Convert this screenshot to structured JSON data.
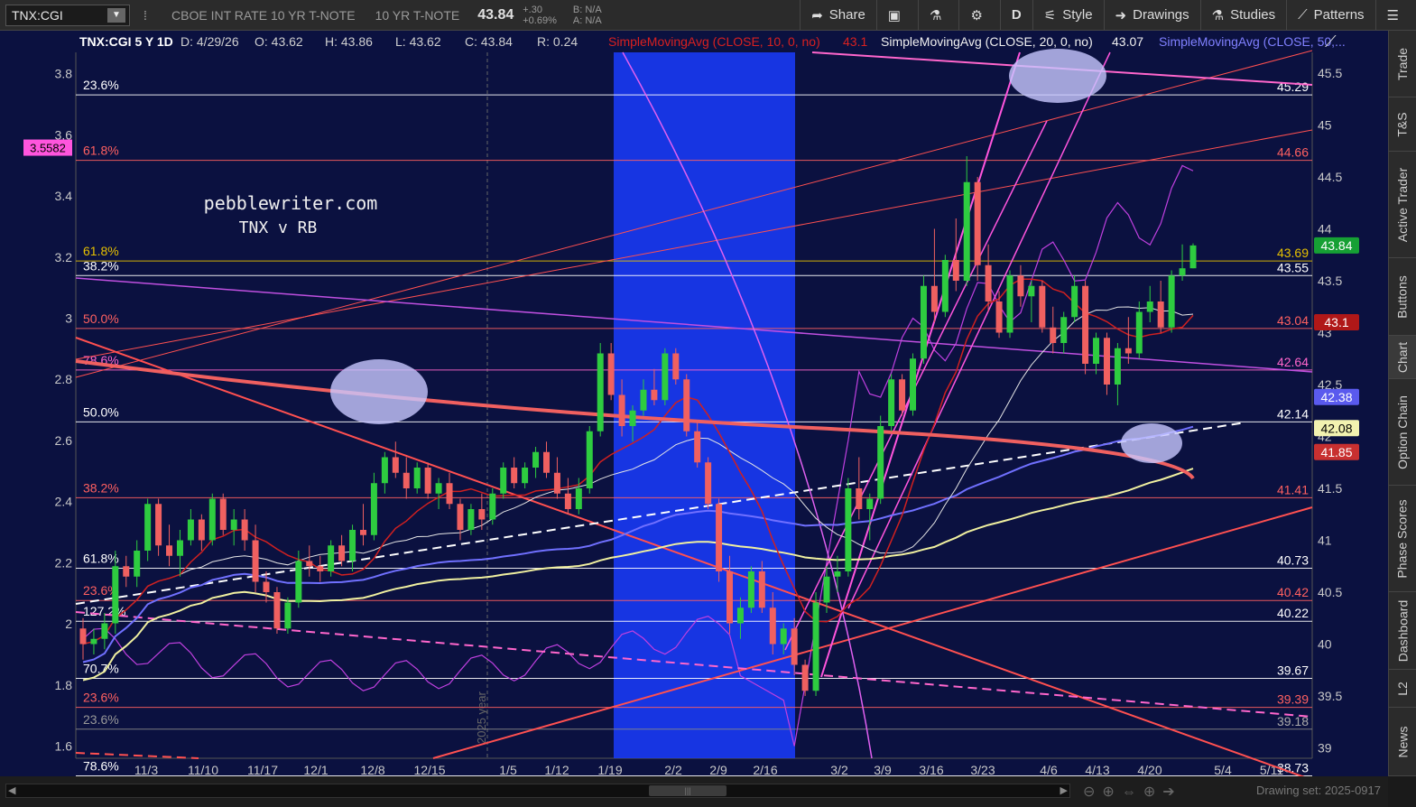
{
  "toolbar": {
    "symbol": "TNX:CGI",
    "description": "CBOE INT RATE 10 YR T-NOTE",
    "short_desc": "10 YR T-NOTE",
    "last": "43.84",
    "change": "+.30",
    "change_pct": "+0.69%",
    "bid": "B: N/A",
    "ask": "A: N/A",
    "share": "Share",
    "period": "D",
    "style": "Style",
    "drawings": "Drawings",
    "studies": "Studies",
    "patterns": "Patterns"
  },
  "sidebar": [
    "Trade",
    "T&S",
    "Active Trader",
    "Buttons",
    "Chart",
    "Option Chain",
    "Phase Scores",
    "Dashboard",
    "L2",
    "News"
  ],
  "header": {
    "symbol_period": "TNX:CGI 5 Y 1D",
    "date": "D: 4/29/26",
    "open": "O: 43.62",
    "high": "H: 43.86",
    "low": "L: 43.62",
    "close": "C: 43.84",
    "range": "R: 0.24",
    "sma10": "SimpleMovingAvg (CLOSE, 10, 0, no)",
    "sma10_val": "43.1",
    "sma20": "SimpleMovingAvg (CLOSE, 20, 0, no)",
    "sma20_val": "43.07",
    "sma50": "SimpleMovingAvg (CLOSE, 50,..."
  },
  "watermark": [
    "pebblewriter.com",
    "TNX v RB"
  ],
  "year_marker": "2025 year",
  "bottom": {
    "drawing_set": "Drawing set: 2025-0917"
  },
  "colors": {
    "background": "#0b1140",
    "up": "#2ecc40",
    "down": "#f06060",
    "sma10": "#d02020",
    "sma20": "#e6e6e6",
    "sma50": "#7070ff",
    "sma200": "#f0f0a0",
    "rb": "#c040e0",
    "channel": "#ff66cc",
    "fib_red": "#ff6060",
    "highlight_band": "#1a3cff"
  },
  "chart_data": {
    "type": "candlestick",
    "x_axis_labels": [
      "11/3",
      "11/10",
      "11/17",
      "12/1",
      "12/8",
      "12/15",
      "1/5",
      "1/12",
      "1/19",
      "2/2",
      "2/9",
      "2/16",
      "3/2",
      "3/9",
      "3/16",
      "3/23",
      "4/6",
      "4/13",
      "4/20",
      "5/4",
      "5/11"
    ],
    "right_axis": {
      "ticks": [
        39,
        39.5,
        40,
        40.5,
        41,
        41.5,
        42,
        42.5,
        43,
        43.5,
        44,
        44.5,
        45,
        45.5
      ],
      "range": [
        38.9,
        45.7
      ]
    },
    "left_axis": {
      "ticks": [
        1.6,
        1.8,
        2,
        2.2,
        2.4,
        2.6,
        2.8,
        3,
        3.2,
        3.4,
        3.6,
        3.8
      ],
      "range": [
        1.56,
        3.87
      ],
      "marker": "3.5582"
    },
    "candles": [
      [
        40.15,
        40.25,
        39.85,
        40.0
      ],
      [
        40.0,
        40.15,
        39.9,
        40.05
      ],
      [
        40.05,
        40.3,
        39.95,
        40.2
      ],
      [
        40.2,
        40.9,
        40.1,
        40.75
      ],
      [
        40.75,
        40.85,
        40.55,
        40.65
      ],
      [
        40.65,
        41.0,
        40.55,
        40.9
      ],
      [
        40.9,
        41.4,
        40.8,
        41.35
      ],
      [
        41.35,
        41.4,
        40.85,
        40.95
      ],
      [
        40.95,
        41.15,
        40.75,
        40.85
      ],
      [
        40.85,
        41.1,
        40.65,
        41.0
      ],
      [
        41.0,
        41.3,
        40.95,
        41.2
      ],
      [
        41.2,
        41.25,
        40.9,
        41.0
      ],
      [
        41.0,
        41.45,
        40.95,
        41.4
      ],
      [
        41.4,
        41.45,
        41.05,
        41.1
      ],
      [
        41.1,
        41.3,
        40.95,
        41.2
      ],
      [
        41.2,
        41.3,
        40.9,
        41.0
      ],
      [
        41.0,
        41.15,
        40.5,
        40.6
      ],
      [
        40.6,
        40.7,
        40.4,
        40.5
      ],
      [
        40.5,
        40.55,
        40.1,
        40.15
      ],
      [
        40.15,
        40.45,
        40.1,
        40.4
      ],
      [
        40.4,
        40.9,
        40.35,
        40.8
      ],
      [
        40.8,
        40.95,
        40.65,
        40.75
      ],
      [
        40.75,
        40.85,
        40.6,
        40.7
      ],
      [
        40.7,
        41.0,
        40.65,
        40.95
      ],
      [
        40.95,
        41.05,
        40.75,
        40.8
      ],
      [
        40.8,
        41.15,
        40.7,
        41.1
      ],
      [
        41.1,
        41.35,
        40.95,
        41.05
      ],
      [
        41.05,
        41.65,
        41.0,
        41.55
      ],
      [
        41.55,
        41.85,
        41.45,
        41.8
      ],
      [
        41.8,
        41.95,
        41.6,
        41.65
      ],
      [
        41.65,
        41.8,
        41.4,
        41.5
      ],
      [
        41.5,
        41.75,
        41.45,
        41.7
      ],
      [
        41.7,
        41.75,
        41.4,
        41.45
      ],
      [
        41.45,
        41.6,
        41.3,
        41.55
      ],
      [
        41.55,
        41.65,
        41.3,
        41.35
      ],
      [
        41.35,
        41.4,
        41.0,
        41.1
      ],
      [
        41.1,
        41.35,
        41.05,
        41.3
      ],
      [
        41.3,
        41.45,
        41.1,
        41.2
      ],
      [
        41.2,
        41.5,
        41.15,
        41.45
      ],
      [
        41.45,
        41.75,
        41.4,
        41.7
      ],
      [
        41.7,
        41.8,
        41.5,
        41.55
      ],
      [
        41.55,
        41.75,
        41.5,
        41.7
      ],
      [
        41.7,
        41.9,
        41.6,
        41.85
      ],
      [
        41.85,
        41.95,
        41.6,
        41.65
      ],
      [
        41.65,
        41.8,
        41.4,
        41.45
      ],
      [
        41.45,
        41.6,
        41.25,
        41.3
      ],
      [
        41.3,
        41.6,
        41.25,
        41.5
      ],
      [
        41.5,
        42.1,
        41.45,
        42.05
      ],
      [
        42.05,
        42.9,
        42.0,
        42.8
      ],
      [
        42.8,
        42.9,
        42.35,
        42.4
      ],
      [
        42.4,
        42.55,
        42.0,
        42.1
      ],
      [
        42.1,
        42.3,
        41.95,
        42.25
      ],
      [
        42.25,
        42.55,
        42.2,
        42.45
      ],
      [
        42.45,
        42.65,
        42.3,
        42.35
      ],
      [
        42.35,
        42.85,
        42.3,
        42.8
      ],
      [
        42.8,
        42.85,
        42.5,
        42.55
      ],
      [
        42.55,
        42.6,
        42.0,
        42.05
      ],
      [
        42.05,
        42.15,
        41.7,
        41.75
      ],
      [
        41.75,
        41.8,
        41.3,
        41.35
      ],
      [
        41.35,
        41.4,
        40.6,
        40.7
      ],
      [
        40.7,
        40.85,
        40.1,
        40.2
      ],
      [
        40.2,
        40.45,
        40.05,
        40.35
      ],
      [
        40.35,
        40.75,
        40.3,
        40.7
      ],
      [
        40.7,
        40.8,
        40.3,
        40.35
      ],
      [
        40.35,
        40.5,
        39.9,
        40.0
      ],
      [
        40.0,
        40.2,
        39.9,
        40.15
      ],
      [
        40.15,
        40.25,
        39.7,
        39.8
      ],
      [
        39.8,
        39.85,
        39.5,
        39.55
      ],
      [
        39.55,
        40.5,
        39.5,
        40.4
      ],
      [
        40.4,
        40.75,
        40.3,
        40.65
      ],
      [
        40.65,
        40.85,
        40.5,
        40.7
      ],
      [
        40.7,
        41.6,
        40.65,
        41.5
      ],
      [
        41.5,
        41.8,
        41.2,
        41.3
      ],
      [
        41.3,
        41.45,
        41.0,
        41.4
      ],
      [
        41.4,
        42.2,
        41.35,
        42.1
      ],
      [
        42.1,
        42.6,
        42.05,
        42.55
      ],
      [
        42.55,
        42.6,
        42.2,
        42.25
      ],
      [
        42.25,
        42.8,
        42.2,
        42.75
      ],
      [
        42.75,
        43.55,
        42.7,
        43.45
      ],
      [
        43.45,
        44.0,
        43.1,
        43.2
      ],
      [
        43.2,
        43.75,
        43.15,
        43.7
      ],
      [
        43.7,
        44.1,
        43.4,
        43.5
      ],
      [
        43.5,
        44.7,
        43.45,
        44.45
      ],
      [
        44.45,
        44.5,
        43.5,
        43.65
      ],
      [
        43.65,
        43.85,
        43.2,
        43.3
      ],
      [
        43.3,
        43.4,
        42.95,
        43.0
      ],
      [
        43.0,
        43.6,
        42.95,
        43.55
      ],
      [
        43.55,
        43.65,
        43.25,
        43.35
      ],
      [
        43.35,
        43.5,
        43.1,
        43.45
      ],
      [
        43.45,
        43.5,
        43.0,
        43.05
      ],
      [
        43.05,
        43.25,
        42.8,
        42.9
      ],
      [
        42.9,
        43.2,
        42.8,
        43.15
      ],
      [
        43.15,
        43.55,
        43.1,
        43.45
      ],
      [
        43.45,
        43.5,
        42.6,
        42.7
      ],
      [
        42.7,
        43.0,
        42.6,
        42.95
      ],
      [
        42.95,
        43.0,
        42.4,
        42.5
      ],
      [
        42.5,
        42.9,
        42.3,
        42.85
      ],
      [
        42.85,
        43.15,
        42.7,
        42.8
      ],
      [
        42.8,
        43.3,
        42.75,
        43.2
      ],
      [
        43.2,
        43.45,
        43.1,
        43.3
      ],
      [
        43.3,
        43.5,
        43.0,
        43.05
      ],
      [
        43.05,
        43.6,
        43.0,
        43.55
      ],
      [
        43.55,
        43.85,
        43.5,
        43.62
      ],
      [
        43.62,
        43.86,
        43.62,
        43.84
      ]
    ],
    "price_levels": [
      {
        "label_left": "23.6%",
        "value": "45.29",
        "color": "#ffffff"
      },
      {
        "label_left": "61.8%",
        "value": "44.66",
        "color": "#ff6060"
      },
      {
        "label_left": "61.8%",
        "value": "43.69",
        "color": "#e6c000"
      },
      {
        "label_left": "38.2%",
        "value": "43.55",
        "color": "#ffffff"
      },
      {
        "label_left": "50.0%",
        "value": "43.04",
        "color": "#ff6060"
      },
      {
        "label_left": "78.6%",
        "value": "42.64",
        "color": "#ff66cc"
      },
      {
        "label_left": "50.0%",
        "value": "42.14",
        "color": "#ffffff"
      },
      {
        "label_left": "38.2%",
        "value": "41.41",
        "color": "#ff6060"
      },
      {
        "label_left": "61.8%",
        "value": "40.73",
        "color": "#ffffff"
      },
      {
        "label_left": "23.6%",
        "value": "40.42",
        "color": "#ff6060"
      },
      {
        "label_left": "127.2%",
        "value": "40.22",
        "color": "#ffffff"
      },
      {
        "label_left": "70.7%",
        "value": "39.67",
        "color": "#ffffff"
      },
      {
        "label_left": "23.6%",
        "value": "39.39",
        "color": "#ff6060"
      },
      {
        "label_left": "23.6%",
        "value": "39.18",
        "color": "#888888"
      },
      {
        "label_left": "78.6%",
        "value": "38.73",
        "color": "#ffffff"
      }
    ],
    "price_tags": [
      {
        "value": "43.84",
        "color": "#16a034",
        "text": "#ffffff"
      },
      {
        "value": "43.1",
        "color": "#b01818",
        "text": "#ffffff"
      },
      {
        "value": "42.38",
        "color": "#5a5aee",
        "text": "#ffffff"
      },
      {
        "value": "42.08",
        "color": "#f2f2b0",
        "text": "#000000"
      },
      {
        "value": "41.85",
        "color": "#c83030",
        "text": "#ffffff"
      }
    ]
  }
}
